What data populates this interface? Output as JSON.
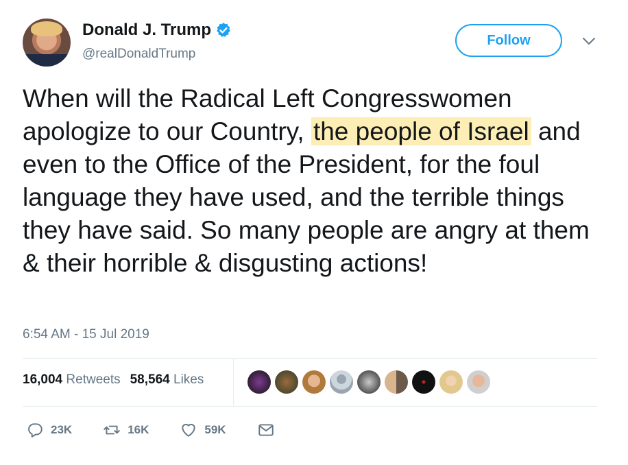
{
  "user": {
    "display_name": "Donald J. Trump",
    "handle": "@realDonaldTrump",
    "verified_icon": "verified-badge-icon",
    "follow_label": "Follow",
    "menu_icon": "chevron-down-icon"
  },
  "tweet": {
    "text_before": "When will the Radical Left Congresswomen apologize to our Country, ",
    "text_highlight": "the people of Israel",
    "text_after": " and even to the Office of the President, for the foul language they have used, and the terrible things they have said. So many people are angry at them & their horrible & disgusting actions!",
    "timestamp": "6:54 AM - 15 Jul 2019"
  },
  "stats": {
    "retweets_count": "16,004",
    "retweets_label": "Retweets",
    "likes_count": "58,564",
    "likes_label": "Likes"
  },
  "likers": {
    "avatar_count": 10
  },
  "actions": {
    "reply_count": "23K",
    "retweet_count": "16K",
    "like_count": "59K",
    "reply_icon": "reply-icon",
    "retweet_icon": "retweet-icon",
    "like_icon": "heart-icon",
    "dm_icon": "direct-message-icon"
  },
  "colors": {
    "accent": "#1da1f2",
    "highlight": "#fdeeb5",
    "secondary_text": "#657786"
  }
}
